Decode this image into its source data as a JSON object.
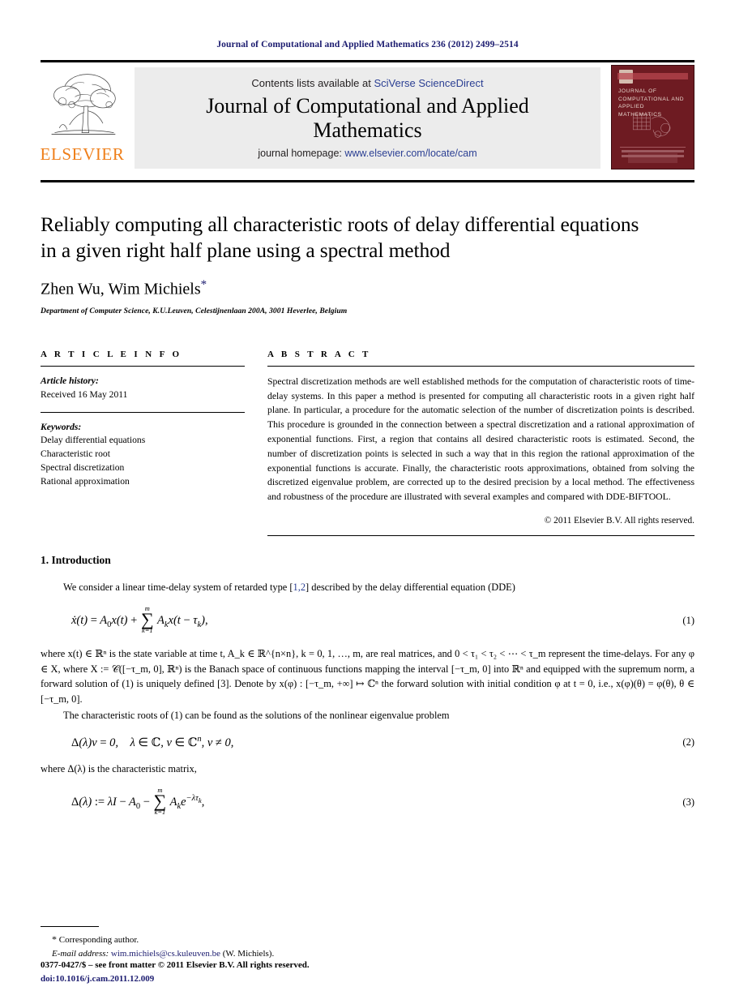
{
  "running_head": "Journal of Computational and Applied Mathematics 236 (2012) 2499–2514",
  "masthead": {
    "publisher_name": "ELSEVIER",
    "contents_prefix": "Contents lists available at ",
    "contents_link": "SciVerse ScienceDirect",
    "journal_title_line1": "Journal of Computational and Applied",
    "journal_title_line2": "Mathematics",
    "homepage_prefix": "journal homepage: ",
    "homepage_url": "www.elsevier.com/locate/cam",
    "cover_title": "JOURNAL OF COMPUTATIONAL AND APPLIED MATHEMATICS"
  },
  "title": {
    "line1": "Reliably computing all characteristic roots of delay differential equations",
    "line2": "in a given right half plane using a spectral method",
    "authors": "Zhen Wu, Wim Michiels",
    "corresponding_marker": "*",
    "affiliation": "Department of Computer Science, K.U.Leuven, Celestijnenlaan 200A, 3001 Heverlee, Belgium"
  },
  "article_info": {
    "heading": "A R T I C L E   I N F O",
    "history_label": "Article history:",
    "history_value": "Received 16 May 2011",
    "keywords_label": "Keywords:",
    "keywords": [
      "Delay differential equations",
      "Characteristic root",
      "Spectral discretization",
      "Rational approximation"
    ]
  },
  "abstract": {
    "heading": "A B S T R A C T",
    "text": "Spectral discretization methods are well established methods for the computation of characteristic roots of time-delay systems. In this paper a method is presented for computing all characteristic roots in a given right half plane. In particular, a procedure for the automatic selection of the number of discretization points is described. This procedure is grounded in the connection between a spectral discretization and a rational approximation of exponential functions. First, a region that contains all desired characteristic roots is estimated. Second, the number of discretization points is selected in such a way that in this region the rational approximation of the exponential functions is accurate. Finally, the characteristic roots approximations, obtained from solving the discretized eigenvalue problem, are corrected up to the desired precision by a local method. The effectiveness and robustness of the procedure are illustrated with several examples and compared with DDE-BIFTOOL.",
    "copyright": "© 2011 Elsevier B.V. All rights reserved."
  },
  "section": {
    "number_title": "1. Introduction",
    "p1_a": "We consider a linear time-delay system of retarded type [",
    "p1_refs": "1,2",
    "p1_b": "] described by the delay differential equation (DDE)",
    "eq1_number": "(1)",
    "eq2_number": "(2)",
    "eq3_number": "(3)",
    "p2_line": "where x(t) ∈ ℝⁿ is the state variable at time t, A_k ∈ ℝ^{n×n}, k = 0, 1, …, m, are real matrices, and 0 < τ₁ < τ₂ < ⋯ < τ_m represent the time-delays. For any φ ∈ X, where X := 𝒞([−τ_m, 0], ℝⁿ) is the Banach space of continuous functions mapping the interval [−τ_m, 0] into ℝⁿ and equipped with the supremum norm, a forward solution of (1) is uniquely defined [3]. Denote by x(φ) : [−τ_m, +∞] ↦ ℂⁿ the forward solution with initial condition φ at t = 0, i.e., x(φ)(θ) = φ(θ), θ ∈ [−τ_m, 0].",
    "p3_line": "The characteristic roots of (1) can be found as the solutions of the nonlinear eigenvalue problem",
    "p4_line": "where Δ(λ) is the characteristic matrix,"
  },
  "footnotes": {
    "corresponding_marker": "*",
    "corresponding_text": "Corresponding author.",
    "email_label": "E-mail address:",
    "email_link": "wim.michiels@cs.kuleuven.be",
    "email_suffix": "(W. Michiels)."
  },
  "imprint": {
    "line1": "0377-0427/$ – see front matter © 2011 Elsevier B.V. All rights reserved.",
    "doi": "doi:10.1016/j.cam.2011.12.009"
  },
  "colors": {
    "link_blue": "#2b3f93",
    "dark_navy": "#1b1b6f",
    "elsevier_orange": "#ef7f1a",
    "cover_maroon": "#6e1b22",
    "banner_grey": "#ececec"
  }
}
